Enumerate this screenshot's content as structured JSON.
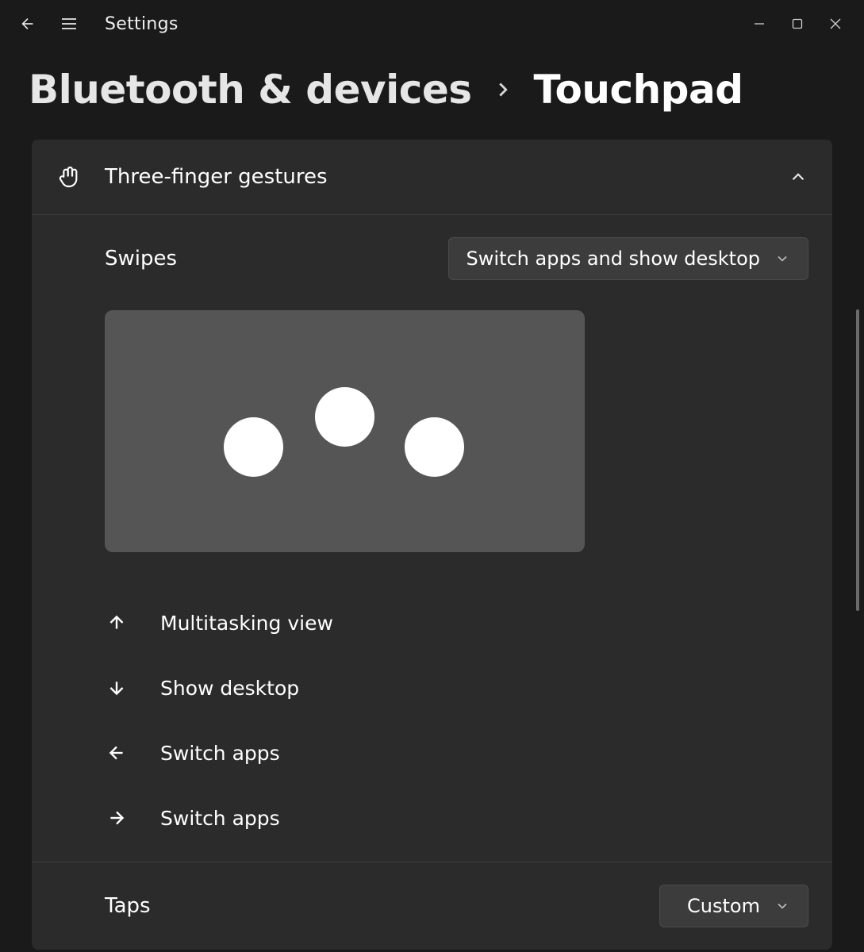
{
  "app": {
    "title": "Settings"
  },
  "breadcrumb": {
    "parent": "Bluetooth & devices",
    "current": "Touchpad"
  },
  "section": {
    "title": "Three-finger gestures",
    "swipes": {
      "label": "Swipes",
      "selected": "Switch apps and show desktop"
    },
    "gestures": {
      "up": "Multitasking view",
      "down": "Show desktop",
      "left": "Switch apps",
      "right": "Switch apps"
    },
    "taps": {
      "label": "Taps",
      "selected": "Custom"
    }
  }
}
